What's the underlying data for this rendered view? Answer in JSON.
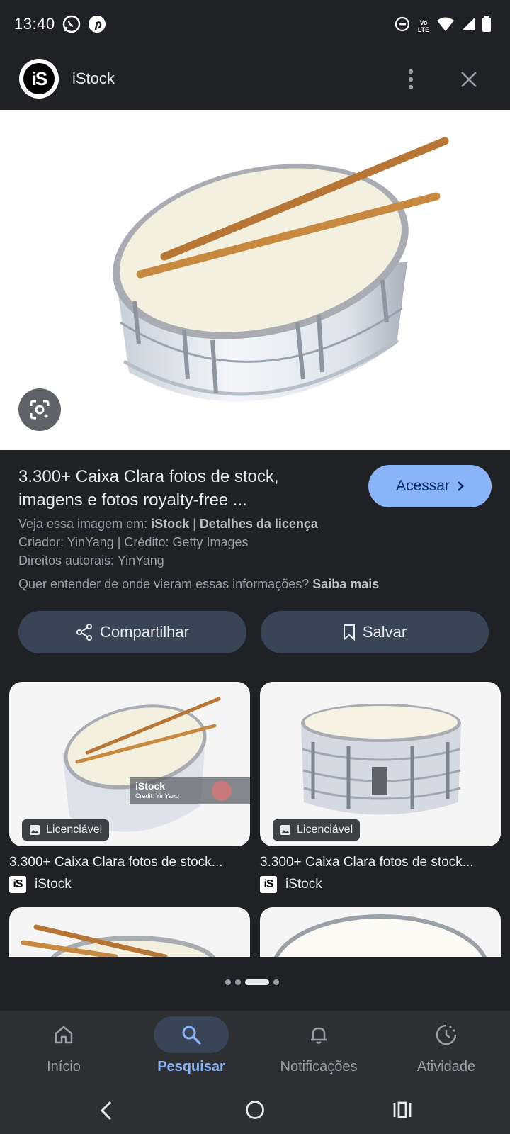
{
  "status": {
    "time": "13:40",
    "network": "Vo LTE"
  },
  "header": {
    "site_name": "iStock",
    "logo_text": "iS"
  },
  "result": {
    "title": "3.300+ Caixa Clara fotos de stock, imagens e fotos royalty-free ...",
    "visit_label": "Acessar",
    "see_prefix": "Veja essa imagem em: ",
    "see_source": "iStock",
    "separator": " | ",
    "license_link": "Detalhes da licença",
    "creator_line": "Criador: YinYang | Crédito: Getty Images",
    "copyright_line": "Direitos autorais: YinYang",
    "info_question": "Quer entender de onde vieram essas informações? ",
    "learn_more": "Saiba mais",
    "share_label": "Compartilhar",
    "save_label": "Salvar"
  },
  "related": [
    {
      "badge": "Licenciável",
      "title": "3.300+ Caixa Clara fotos de stock...",
      "source": "iStock",
      "watermark_title": "iStock",
      "watermark_credit": "Credit: YinYang"
    },
    {
      "badge": "Licenciável",
      "title": "3.300+ Caixa Clara fotos de stock...",
      "source": "iStock"
    }
  ],
  "pagination": {
    "count": 4,
    "active_index": 2
  },
  "nav": {
    "items": [
      {
        "label": "Início",
        "icon": "home-icon"
      },
      {
        "label": "Pesquisar",
        "icon": "search-icon",
        "active": true
      },
      {
        "label": "Notificações",
        "icon": "bell-icon"
      },
      {
        "label": "Atividade",
        "icon": "activity-icon"
      }
    ]
  },
  "colors": {
    "background": "#202124",
    "accent": "#8ab4f8",
    "button_surface": "#394457"
  }
}
